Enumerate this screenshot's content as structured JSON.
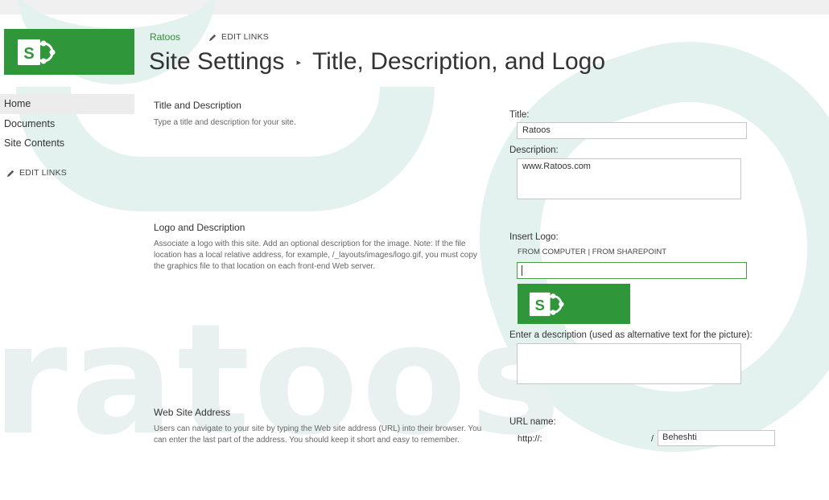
{
  "site": {
    "name": "Ratoos",
    "edit_links": "EDIT LINKS"
  },
  "title": {
    "section": "Site Settings",
    "page": "Title, Description, and Logo"
  },
  "nav": {
    "items": [
      {
        "label": "Home"
      },
      {
        "label": "Documents"
      },
      {
        "label": "Site Contents"
      }
    ],
    "edit_links": "EDIT LINKS"
  },
  "sections": {
    "title_desc": {
      "heading": "Title and Description",
      "desc": "Type a title and description for your site."
    },
    "logo": {
      "heading": "Logo and Description",
      "desc": "Associate a logo with this site. Add an optional description for the image. Note: If the file location has a local relative address, for example, /_layouts/images/logo.gif, you must copy the graphics file to that location on each front-end Web server."
    },
    "web_address": {
      "heading": "Web Site Address",
      "desc": "Users can navigate to your site by typing the Web site address (URL) into their browser. You can enter the last part of the address. You should keep it short and easy to remember."
    }
  },
  "form": {
    "title_label": "Title:",
    "title_value": "Ratoos",
    "description_label": "Description:",
    "description_value": "www.Ratoos.com",
    "insert_logo_label": "Insert Logo:",
    "from_computer": "FROM COMPUTER",
    "link_separator": " | ",
    "from_sharepoint": "FROM SHAREPOINT",
    "logo_url_value": "",
    "alt_text_label": "Enter a description (used as alternative text for the picture):",
    "alt_text_value": "",
    "url_label": "URL name:",
    "url_prefix": "http://:",
    "url_slash": "/",
    "url_value": "Beheshti"
  },
  "watermark": {
    "text": "ratoos"
  },
  "colors": {
    "brand_green": "#2f9639",
    "link_green": "#2f8a36",
    "watermark": "#e4f2ef"
  },
  "icons": {
    "logo": "sharepoint-logo-icon",
    "pencil": "pencil-icon",
    "separator": "triangle-right-icon"
  }
}
